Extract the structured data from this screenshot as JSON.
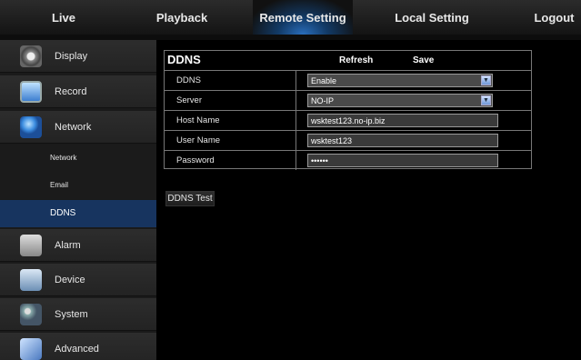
{
  "topnav": {
    "live": "Live",
    "playback": "Playback",
    "remote_setting": "Remote Setting",
    "local_setting": "Local Setting",
    "logout": "Logout"
  },
  "sidebar": {
    "items": [
      {
        "label": "Display",
        "icon": "display-icon"
      },
      {
        "label": "Record",
        "icon": "record-icon"
      },
      {
        "label": "Network",
        "icon": "network-icon"
      },
      {
        "label": "Alarm",
        "icon": "alarm-icon"
      },
      {
        "label": "Device",
        "icon": "device-icon"
      },
      {
        "label": "System",
        "icon": "system-icon"
      },
      {
        "label": "Advanced",
        "icon": "advanced-icon"
      }
    ],
    "network_sub": [
      {
        "label": "Network"
      },
      {
        "label": "Email"
      },
      {
        "label": "DDNS",
        "active": true
      }
    ]
  },
  "panel": {
    "title": "DDNS",
    "refresh_label": "Refresh",
    "save_label": "Save",
    "fields": {
      "ddns": {
        "label": "DDNS",
        "value": "Enable"
      },
      "server": {
        "label": "Server",
        "value": "NO-IP"
      },
      "host_name": {
        "label": "Host Name",
        "value": "wsktest123.no-ip.biz"
      },
      "user_name": {
        "label": "User Name",
        "value": "wsktest123"
      },
      "password": {
        "label": "Password",
        "value": "••••••"
      }
    }
  },
  "ddns_test_label": "DDNS Test",
  "colors": {
    "active_tab_glow": "#2a6ebc",
    "active_sub_bg": "#17345f"
  }
}
